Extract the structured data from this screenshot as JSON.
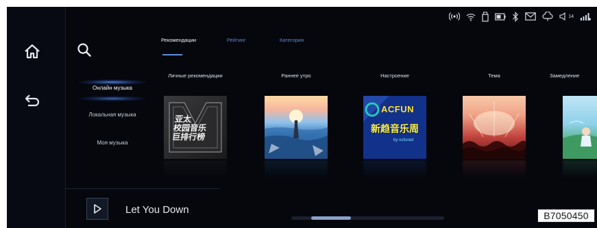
{
  "status_bar": {
    "icons": [
      "radio-signal-icon",
      "wifi-icon",
      "usb-icon",
      "battery-icon",
      "bluetooth-icon",
      "message-icon",
      "cloud-icon",
      "volume-icon",
      "cellular-signal-icon"
    ],
    "volume_level": "14"
  },
  "rail": {
    "home_icon": "home-icon",
    "back_icon": "back-icon"
  },
  "search": {
    "icon": "search-icon"
  },
  "sidebar": {
    "items": [
      {
        "label": "Онлайн музыка",
        "active": true
      },
      {
        "label": "Локальная музыка",
        "active": false
      },
      {
        "label": "Моя музыка",
        "active": false
      }
    ]
  },
  "tabs": [
    {
      "label": "Рекомендации",
      "active": true
    },
    {
      "label": "Рейтинг",
      "active": false
    },
    {
      "label": "Категория",
      "active": false
    }
  ],
  "cards": [
    {
      "title": "Личные рекомендации"
    },
    {
      "title": "Раннее утро"
    },
    {
      "title": "Настроение"
    },
    {
      "title": "Тема"
    },
    {
      "title": "Замедление"
    }
  ],
  "covers": {
    "card1_lines": [
      "亚太",
      "校园音乐",
      "巨排行榜"
    ],
    "card3_logo": "ACFUN",
    "card3_text": "新趋音乐周",
    "card3_sub": "by ocfuned"
  },
  "player": {
    "song_title": "Let You Down",
    "play_icon": "play-icon"
  },
  "pager": {
    "position": 0.26
  },
  "watermark": {
    "code": "B7050450"
  },
  "colors": {
    "background": "#05070d",
    "accent": "#5a8fe0",
    "tab_inactive": "#5f86d6",
    "text": "#dde3ec"
  }
}
